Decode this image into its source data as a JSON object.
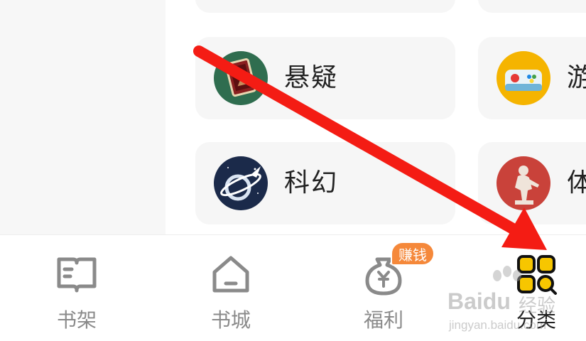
{
  "categories": [
    {
      "label": "悬疑",
      "icon": "mystery-card-icon"
    },
    {
      "label": "游",
      "icon": "game-controller-icon"
    },
    {
      "label": "科幻",
      "icon": "scifi-planet-icon"
    },
    {
      "label": "体",
      "icon": "sports-statue-icon"
    }
  ],
  "bottom_nav": {
    "items": [
      {
        "label": "书架",
        "icon": "bookshelf-icon"
      },
      {
        "label": "书城",
        "icon": "home-icon"
      },
      {
        "label": "福利",
        "icon": "money-bag-icon"
      },
      {
        "label": "分类",
        "icon": "category-grid-icon"
      }
    ],
    "badge": "赚钱",
    "active_index": 3
  },
  "colors": {
    "accent_yellow": "#f7c600",
    "badge_orange": "#f5883a",
    "arrow_red": "#f41c14"
  },
  "watermark": {
    "brand": "Baidu",
    "brand_cn": "经验",
    "url": "jingyan.baidu.com"
  }
}
